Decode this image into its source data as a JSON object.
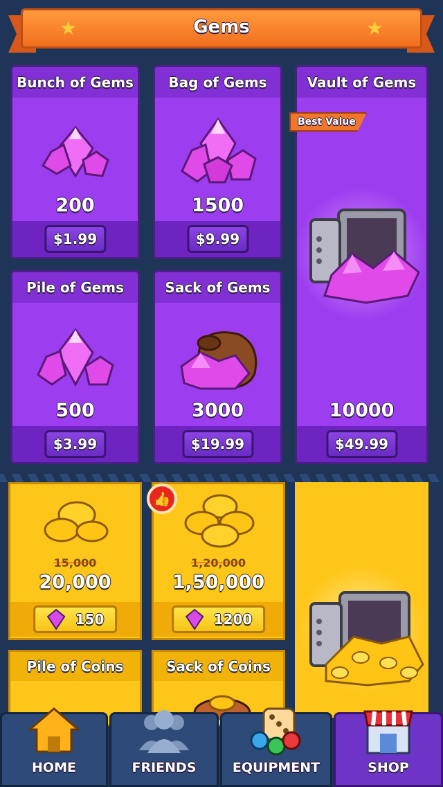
{
  "header": {
    "title": "Gems"
  },
  "gem_packs": [
    {
      "title": "Bunch of Gems",
      "amount": "200",
      "price": "$1.99"
    },
    {
      "title": "Bag of Gems",
      "amount": "1500",
      "price": "$9.99"
    },
    {
      "title": "Vault of Gems",
      "amount": "10000",
      "price": "$49.99",
      "badge": "Best Value"
    },
    {
      "title": "Pile of Gems",
      "amount": "500",
      "price": "$3.99"
    },
    {
      "title": "Sack of Gems",
      "amount": "3000",
      "price": "$19.99"
    }
  ],
  "coin_packs": [
    {
      "title": "",
      "old_amount": "15,000",
      "amount": "20,000",
      "gem_cost": "150"
    },
    {
      "title": "",
      "old_amount": "1,20,000",
      "amount": "1,50,000",
      "gem_cost": "1200"
    },
    {
      "title": "Pile of Coins"
    },
    {
      "title": "Sack of Coins"
    }
  ],
  "nav": [
    {
      "label": "HOME",
      "icon": "home-icon"
    },
    {
      "label": "FRIENDS",
      "icon": "friends-icon"
    },
    {
      "label": "EQUIPMENT",
      "icon": "dice-icon"
    },
    {
      "label": "SHOP",
      "icon": "shop-icon",
      "active": true
    }
  ],
  "colors": {
    "gem_card": "#9d3df0",
    "coin_card": "#ffc61a",
    "header": "#f26f1f",
    "background": "#1e3558"
  }
}
